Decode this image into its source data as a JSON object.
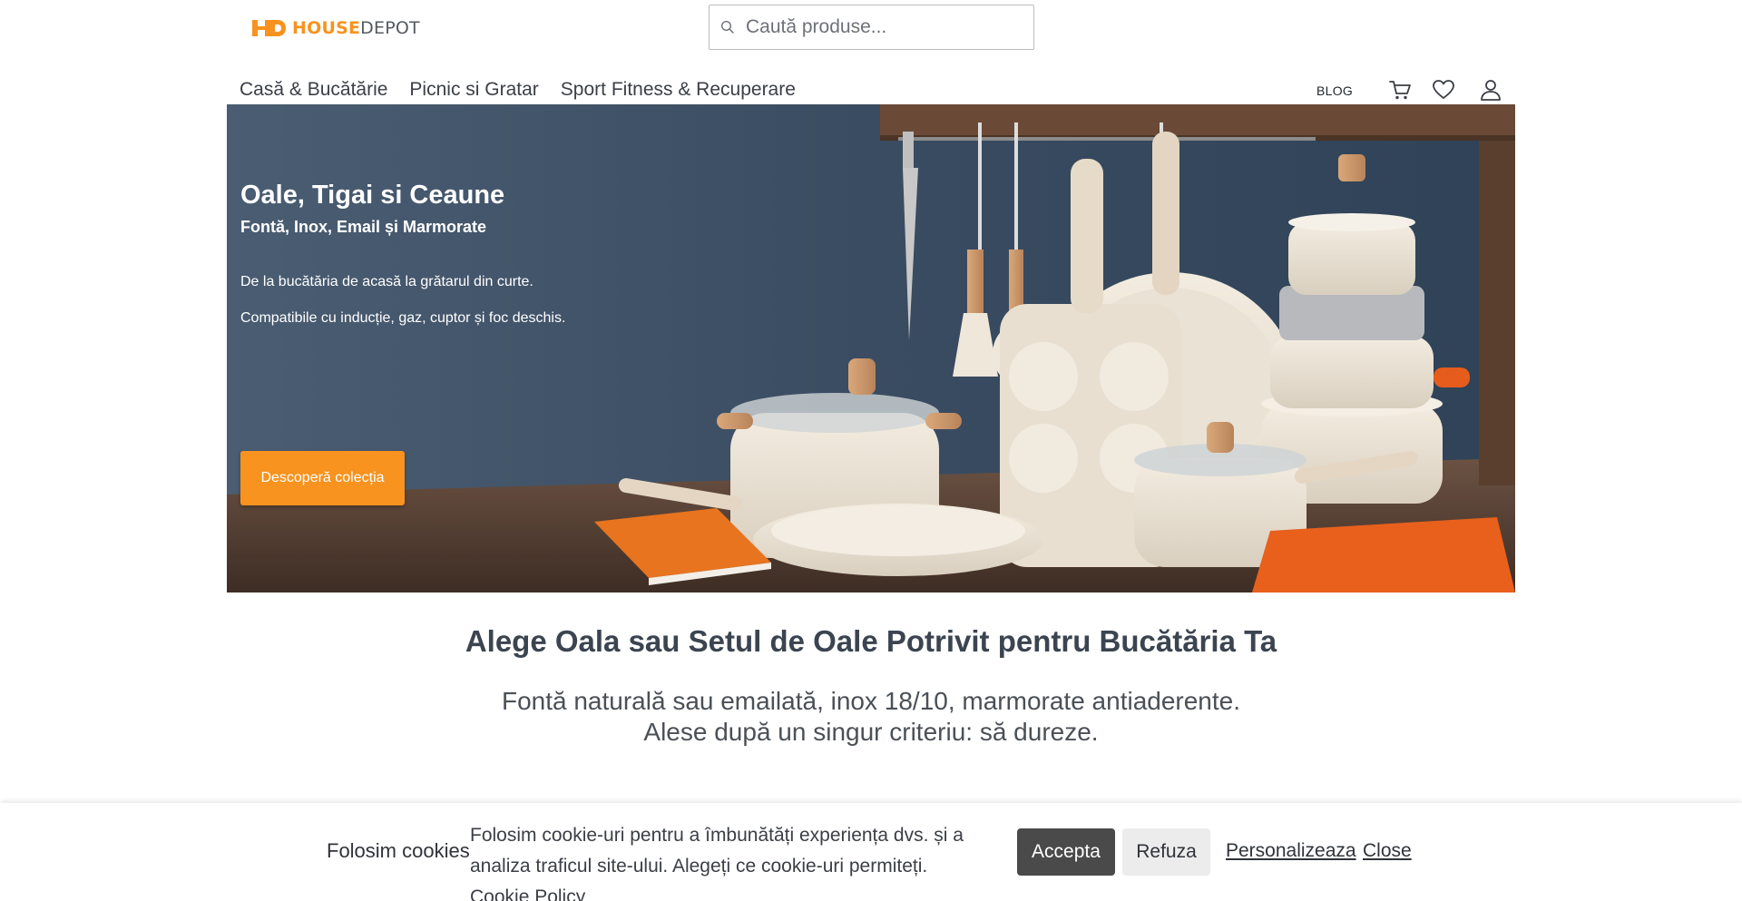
{
  "brand": {
    "logo_house": "HOUSE",
    "logo_depot": "DEPOT",
    "accent_color": "#f7931e"
  },
  "search": {
    "placeholder": "Caută produse...",
    "value": ""
  },
  "nav": {
    "items": [
      "Casă & Bucătărie",
      "Picnic si Gratar",
      "Sport Fitness & Recuperare"
    ],
    "blog_label": "BLOG",
    "icons": [
      "cart-icon",
      "heart-icon",
      "user-icon"
    ]
  },
  "hero": {
    "title": "Oale, Tigai si Ceaune",
    "subtitle": "Fontă, Inox, Email și Marmorate",
    "line1": "De la bucătăria de acasă la grătarul din curte.",
    "line2": "Compatibile cu inducție, gaz, cuptor și foc deschis.",
    "cta_label": "Descoperă colecția"
  },
  "section": {
    "title": "Alege Oala sau Setul de Oale Potrivit pentru Bucătăria Ta",
    "desc_line1": "Fontă naturală sau emailată, inox 18/10, marmorate antiaderente.",
    "desc_line2": "Alese după un singur criteriu: să dureze."
  },
  "cookie": {
    "title": "Folosim cookies",
    "text": "Folosim cookie-uri pentru a îmbunătăți experiența dvs. și a analiza traficul site-ului. Alegeți ce cookie-uri permiteți.",
    "policy_link": "Cookie Policy",
    "accept_label": "Accepta",
    "refuse_label": "Refuza",
    "customize_label": "Personalizeaza",
    "close_label": "Close"
  }
}
